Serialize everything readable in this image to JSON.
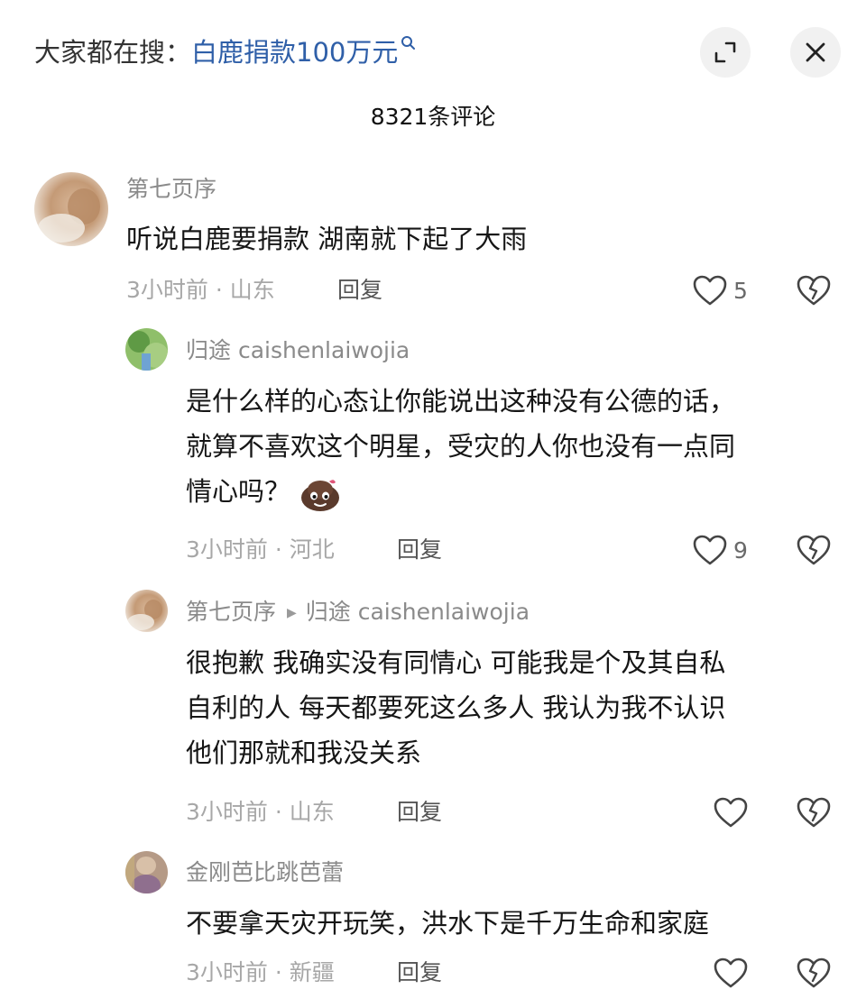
{
  "header": {
    "search_prefix": "大家都在搜：",
    "search_term": "白鹿捐款100万元",
    "comment_count": "8321条评论",
    "icons": {
      "search": "search-icon",
      "collapse": "collapse-icon",
      "close": "close-icon"
    }
  },
  "comments": [
    {
      "author": "第七页序",
      "text": "听说白鹿要捐款 湖南就下起了大雨",
      "time_location": "3小时前 · 山东",
      "reply_label": "回复",
      "likes": "5"
    },
    {
      "author": "归途 caishenlaiwojia",
      "text_lines": [
        "是什么样的心态让你能说出这种没有公德的话，",
        "就算不喜欢这个明星，受灾的人你也没有一点同",
        "情心吗？"
      ],
      "time_location": "3小时前 · 河北",
      "reply_label": "回复",
      "likes": "9",
      "emoji": "poop-face-emoji"
    },
    {
      "author": "第七页序",
      "reply_to": "归途 caishenlaiwojia",
      "text_lines": [
        "很抱歉 我确实没有同情心 可能我是个及其自私",
        "自利的人 每天都要死这么多人 我认为我不认识",
        "他们那就和我没关系"
      ],
      "time_location": "3小时前 · 山东",
      "reply_label": "回复",
      "likes": ""
    },
    {
      "author": "金刚芭比跳芭蕾",
      "text": "不要拿天灾开玩笑，洪水下是千万生命和家庭",
      "time_location": "3小时前 · 新疆",
      "reply_label": "回复",
      "likes": ""
    }
  ],
  "colors": {
    "search_term": "#2f5fa8",
    "muted": "#a7a7a7",
    "author": "#8a8a8a"
  }
}
